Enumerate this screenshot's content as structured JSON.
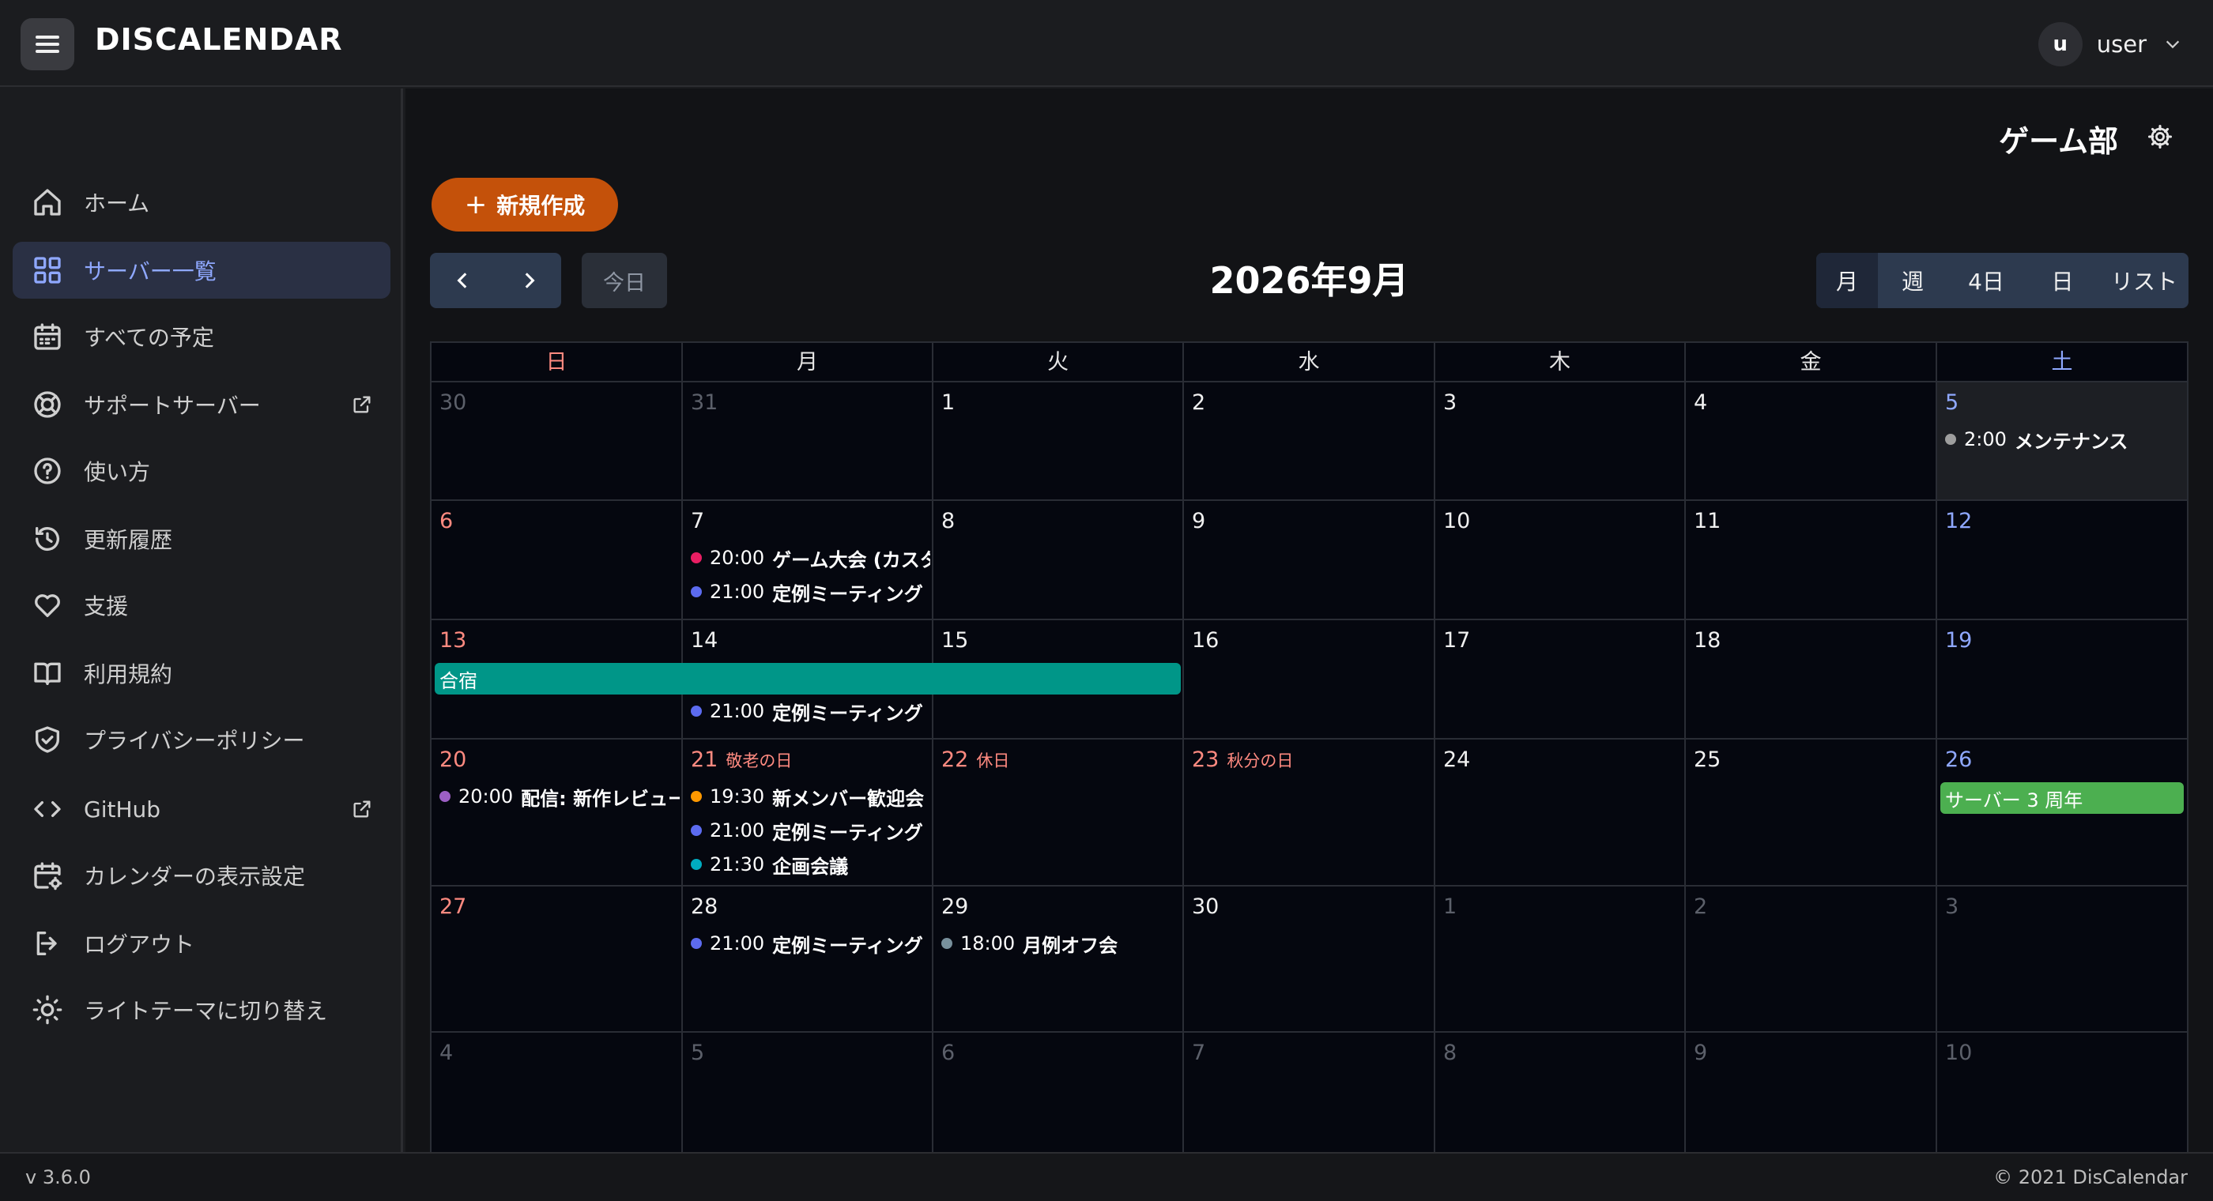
{
  "app": {
    "logo": "DISCALENDAR"
  },
  "user": {
    "avatar_letter": "u",
    "name": "user"
  },
  "sidebar": {
    "items": [
      {
        "label": "ホーム",
        "icon": "home-icon"
      },
      {
        "label": "サーバー一覧",
        "icon": "grid-icon",
        "active": true
      },
      {
        "label": "すべての予定",
        "icon": "calendar-icon"
      },
      {
        "label": "サポートサーバー",
        "icon": "lifebuoy-icon",
        "external": true
      },
      {
        "label": "使い方",
        "icon": "help-icon"
      },
      {
        "label": "更新履歴",
        "icon": "history-icon"
      },
      {
        "label": "支援",
        "icon": "heart-icon"
      },
      {
        "label": "利用規約",
        "icon": "book-icon"
      },
      {
        "label": "プライバシーポリシー",
        "icon": "shield-icon"
      },
      {
        "label": "GitHub",
        "icon": "code-icon",
        "external": true
      },
      {
        "label": "カレンダーの表示設定",
        "icon": "calendar-settings-icon"
      },
      {
        "label": "ログアウト",
        "icon": "logout-icon"
      },
      {
        "label": "ライトテーマに切り替え",
        "icon": "sun-icon"
      }
    ]
  },
  "server": {
    "name": "ゲーム部"
  },
  "toolbar": {
    "new_label": "新規作成",
    "today_label": "今日",
    "month_title": "2026年9月",
    "views": [
      "月",
      "週",
      "4日",
      "日",
      "リスト"
    ],
    "active_view": "月"
  },
  "calendar": {
    "weekdays": [
      "日",
      "月",
      "火",
      "水",
      "木",
      "金",
      "土"
    ],
    "weeks": [
      [
        {
          "d": "30",
          "o": true
        },
        {
          "d": "31",
          "o": true
        },
        {
          "d": "1"
        },
        {
          "d": "2"
        },
        {
          "d": "3"
        },
        {
          "d": "4"
        },
        {
          "d": "5",
          "today": true
        }
      ],
      [
        {
          "d": "6"
        },
        {
          "d": "7"
        },
        {
          "d": "8"
        },
        {
          "d": "9"
        },
        {
          "d": "10"
        },
        {
          "d": "11"
        },
        {
          "d": "12"
        }
      ],
      [
        {
          "d": "13"
        },
        {
          "d": "14"
        },
        {
          "d": "15"
        },
        {
          "d": "16"
        },
        {
          "d": "17"
        },
        {
          "d": "18"
        },
        {
          "d": "19"
        }
      ],
      [
        {
          "d": "20"
        },
        {
          "d": "21",
          "h": "敬老の日"
        },
        {
          "d": "22",
          "h": "休日"
        },
        {
          "d": "23",
          "h": "秋分の日"
        },
        {
          "d": "24"
        },
        {
          "d": "25"
        },
        {
          "d": "26"
        }
      ],
      [
        {
          "d": "27"
        },
        {
          "d": "28"
        },
        {
          "d": "29"
        },
        {
          "d": "30"
        },
        {
          "d": "1",
          "o": true
        },
        {
          "d": "2",
          "o": true
        },
        {
          "d": "3",
          "o": true
        }
      ],
      [
        {
          "d": "4",
          "o": true
        },
        {
          "d": "5",
          "o": true
        },
        {
          "d": "6",
          "o": true
        },
        {
          "d": "7",
          "o": true
        },
        {
          "d": "8",
          "o": true
        },
        {
          "d": "9",
          "o": true
        },
        {
          "d": "10",
          "o": true
        }
      ]
    ],
    "events": [
      {
        "week": 0,
        "day": 6,
        "slot": 0,
        "time": "2:00",
        "title": "メンテナンス",
        "color": "#9e9e9e"
      },
      {
        "week": 1,
        "day": 1,
        "slot": 0,
        "time": "20:00",
        "title": "ゲーム大会 (カスタ",
        "color": "#e91e63"
      },
      {
        "week": 1,
        "day": 1,
        "slot": 1,
        "time": "21:00",
        "title": "定例ミーティング",
        "color": "#5c6bf0"
      },
      {
        "week": 2,
        "day": 1,
        "slot": 1,
        "time": "21:00",
        "title": "定例ミーティング",
        "color": "#5c6bf0"
      },
      {
        "week": 3,
        "day": 0,
        "slot": 0,
        "time": "20:00",
        "title": "配信: 新作レビュー",
        "color": "#9c5fc4"
      },
      {
        "week": 3,
        "day": 1,
        "slot": 0,
        "time": "19:30",
        "title": "新メンバー歓迎会",
        "color": "#ff9800"
      },
      {
        "week": 3,
        "day": 1,
        "slot": 1,
        "time": "21:00",
        "title": "定例ミーティング",
        "color": "#5c6bf0"
      },
      {
        "week": 3,
        "day": 1,
        "slot": 2,
        "time": "21:30",
        "title": "企画会議",
        "color": "#00acc1"
      },
      {
        "week": 4,
        "day": 1,
        "slot": 0,
        "time": "21:00",
        "title": "定例ミーティング",
        "color": "#5c6bf0"
      },
      {
        "week": 4,
        "day": 2,
        "slot": 0,
        "time": "18:00",
        "title": "月例オフ会",
        "color": "#78909c"
      }
    ],
    "allday": [
      {
        "week": 2,
        "start": 0,
        "span": 3,
        "title": "合宿",
        "color": "#009688"
      },
      {
        "week": 3,
        "start": 6,
        "span": 1,
        "title": "サーバー 3 周年",
        "color": "#4caf50"
      }
    ]
  },
  "footer": {
    "version": "v 3.6.0",
    "copyright": "© 2021 DisCalendar"
  }
}
